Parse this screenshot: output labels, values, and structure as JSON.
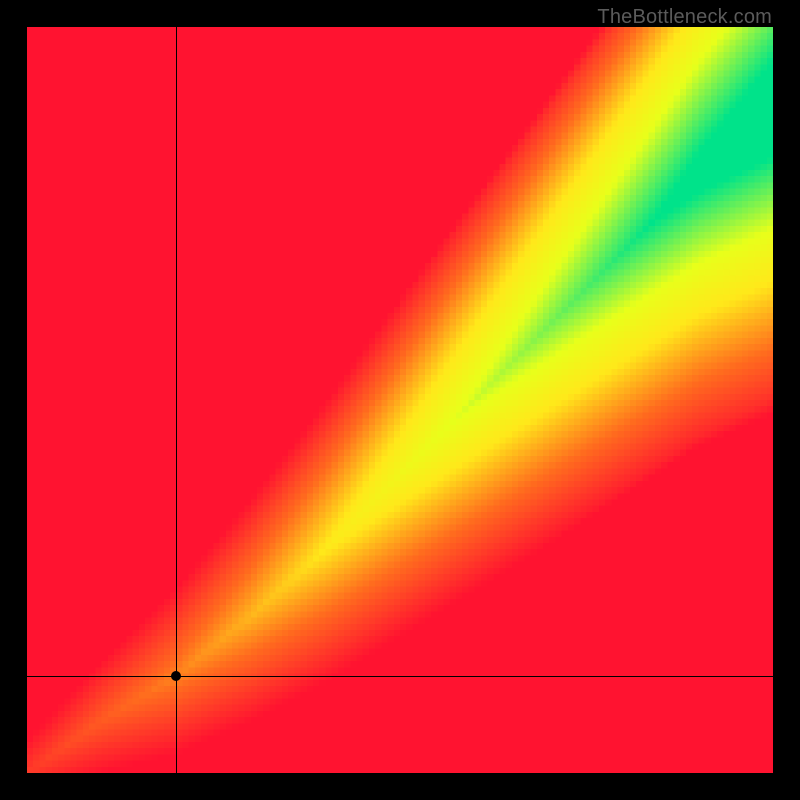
{
  "watermark": "TheBottleneck.com",
  "chart_data": {
    "type": "heatmap",
    "title": "",
    "xlabel": "",
    "ylabel": "",
    "xlim": [
      0,
      100
    ],
    "ylim": [
      0,
      100
    ],
    "grid": false,
    "legend": false,
    "colormap": {
      "stops": [
        {
          "t": 0.0,
          "color": "#ff1330"
        },
        {
          "t": 0.25,
          "color": "#ff6b1e"
        },
        {
          "t": 0.5,
          "color": "#ffe81a"
        },
        {
          "t": 0.7,
          "color": "#e8ff1a"
        },
        {
          "t": 1.0,
          "color": "#00e38a"
        }
      ]
    },
    "optimal_band": {
      "description": "Green band centre follows a slightly super-linear diagonal from bottom-left to top-right; band widens toward the top-right.",
      "centre_points": [
        {
          "x": 0,
          "y": 0
        },
        {
          "x": 10,
          "y": 7
        },
        {
          "x": 20,
          "y": 13
        },
        {
          "x": 30,
          "y": 21
        },
        {
          "x": 40,
          "y": 30
        },
        {
          "x": 50,
          "y": 40
        },
        {
          "x": 60,
          "y": 50
        },
        {
          "x": 70,
          "y": 60
        },
        {
          "x": 80,
          "y": 70
        },
        {
          "x": 90,
          "y": 80
        },
        {
          "x": 100,
          "y": 88
        }
      ],
      "half_width_start": 2,
      "half_width_end": 9
    },
    "crosshair": {
      "x": 20,
      "y": 13
    },
    "marker": {
      "x": 20,
      "y": 13
    }
  }
}
